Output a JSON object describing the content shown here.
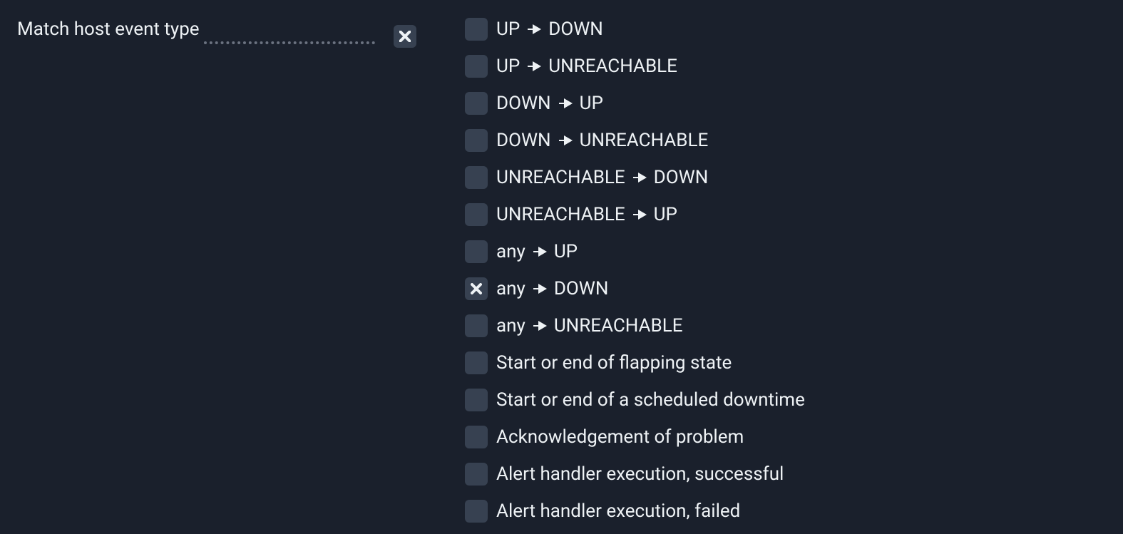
{
  "colors": {
    "background": "#1a202c",
    "text": "#e8ecef",
    "box": "#374151"
  },
  "condition": {
    "label": "Match host event type",
    "enabled": true
  },
  "host_events": [
    {
      "id": "up_down",
      "checked": false,
      "from": "UP",
      "to": "DOWN"
    },
    {
      "id": "up_unreachable",
      "checked": false,
      "from": "UP",
      "to": "UNREACHABLE"
    },
    {
      "id": "down_up",
      "checked": false,
      "from": "DOWN",
      "to": "UP"
    },
    {
      "id": "down_unreachable",
      "checked": false,
      "from": "DOWN",
      "to": "UNREACHABLE"
    },
    {
      "id": "unreachable_down",
      "checked": false,
      "from": "UNREACHABLE",
      "to": "DOWN"
    },
    {
      "id": "unreachable_up",
      "checked": false,
      "from": "UNREACHABLE",
      "to": "UP"
    },
    {
      "id": "any_up",
      "checked": false,
      "from": "any",
      "to": "UP"
    },
    {
      "id": "any_down",
      "checked": true,
      "from": "any",
      "to": "DOWN"
    },
    {
      "id": "any_unreachable",
      "checked": false,
      "from": "any",
      "to": "UNREACHABLE"
    },
    {
      "id": "flapping",
      "checked": false,
      "label": "Start or end of flapping state"
    },
    {
      "id": "downtime",
      "checked": false,
      "label": "Start or end of a scheduled downtime"
    },
    {
      "id": "ack",
      "checked": false,
      "label": "Acknowledgement of problem"
    },
    {
      "id": "alert_ok",
      "checked": false,
      "label": "Alert handler execution, successful"
    },
    {
      "id": "alert_fail",
      "checked": false,
      "label": "Alert handler execution, failed"
    }
  ]
}
